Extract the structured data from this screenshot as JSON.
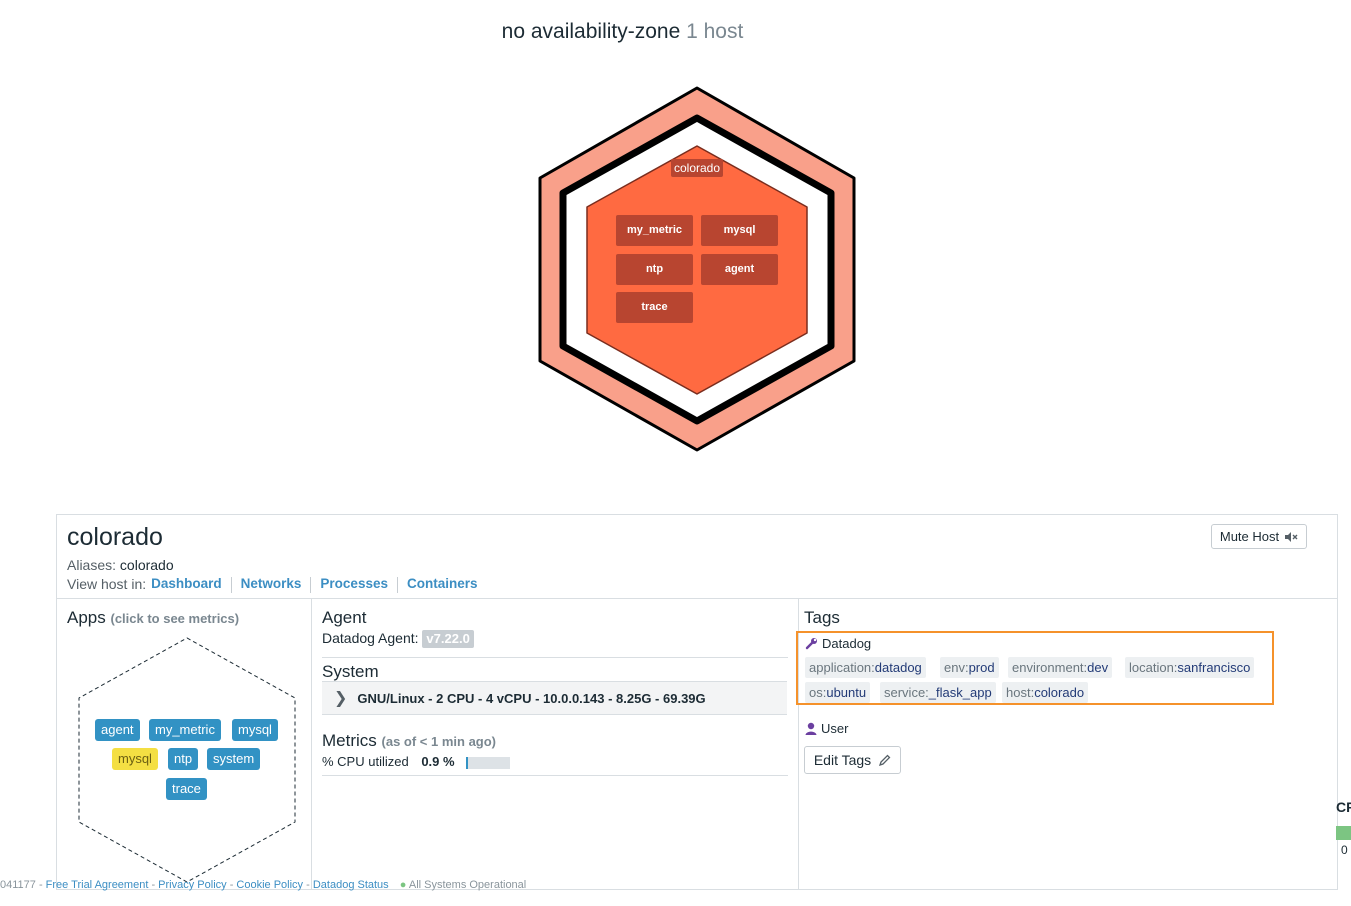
{
  "zone": {
    "name": "no availability-zone",
    "count": "1 host"
  },
  "hexmap": {
    "host_label": "colorado",
    "apps": [
      "my_metric",
      "mysql",
      "ntp",
      "agent",
      "trace"
    ],
    "colors": {
      "outer": "#f9a08a",
      "inner": "#ff6a41",
      "app": "#b84530"
    }
  },
  "host": {
    "name": "colorado",
    "aliases_label": "Aliases:",
    "aliases_value": "colorado",
    "view_in_label": "View host in:",
    "links": [
      "Dashboard",
      "Networks",
      "Processes",
      "Containers"
    ],
    "mute_label": "Mute Host"
  },
  "apps": {
    "title": "Apps",
    "subtitle": "(click to see metrics)",
    "pills": [
      "agent",
      "my_metric",
      "mysql",
      "mysql",
      "ntp",
      "system",
      "trace"
    ]
  },
  "agent": {
    "title": "Agent",
    "label": "Datadog Agent:",
    "version": "v7.22.0"
  },
  "system": {
    "title": "System",
    "summary": "GNU/Linux - 2 CPU - 4 vCPU - 10.0.0.143 - 8.25G - 69.39G"
  },
  "metrics": {
    "title": "Metrics",
    "subtitle": "(as of < 1 min ago)",
    "cpu_label": "% CPU utilized",
    "cpu_value": "0.9 %",
    "cpu_fraction": 0.009
  },
  "tags": {
    "title": "Tags",
    "datadog_label": "Datadog",
    "items": [
      {
        "k": "application:",
        "v": "datadog"
      },
      {
        "k": "env:",
        "v": "prod"
      },
      {
        "k": "environment:",
        "v": "dev"
      },
      {
        "k": "location:",
        "v": "sanfrancisco"
      },
      {
        "k": "os:",
        "v": "ubuntu"
      },
      {
        "k": "service:",
        "v": "_flask_app"
      },
      {
        "k": "host:",
        "v": "colorado"
      }
    ],
    "user_label": "User",
    "edit_label": "Edit Tags",
    "highlight_color": "#f5922b"
  },
  "footer": {
    "prefix": "041177 -",
    "links": [
      "Free Trial Agreement",
      "Privacy Policy",
      "Cookie Policy",
      "Datadog Status"
    ],
    "status": "All Systems Operational"
  },
  "cutoff": {
    "header": "CP",
    "value": "0"
  }
}
